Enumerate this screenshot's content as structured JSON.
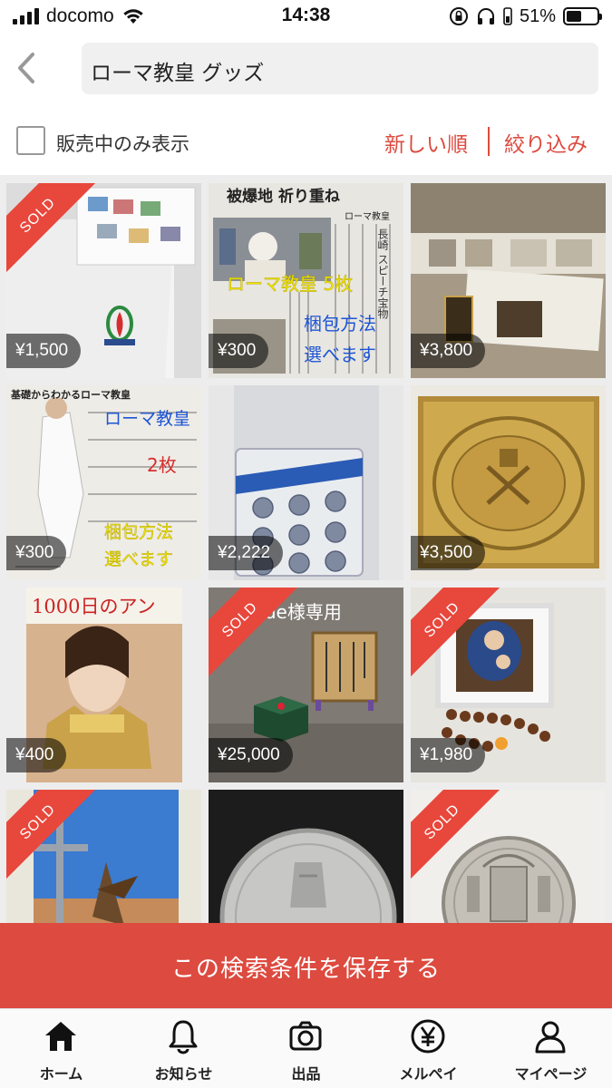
{
  "status_bar": {
    "carrier": "docomo",
    "time": "14:38",
    "battery": "51%",
    "battery_level": 0.51
  },
  "search": {
    "query": "ローマ教皇 グッズ"
  },
  "filter": {
    "on_sale_only_label": "販売中のみ表示",
    "sort_label": "新しい順",
    "filter_label": "絞り込み"
  },
  "items": [
    {
      "price": "¥1,500",
      "sold": true,
      "sold_label": "SOLD"
    },
    {
      "price": "¥300",
      "sold": false,
      "image_text": [
        "被爆地 祈り重ね",
        "ローマ教皇",
        "長崎 スピーチ宝物",
        "ローマ教皇 5枚",
        "梱包方法",
        "選べます"
      ]
    },
    {
      "price": "¥3,800",
      "sold": false
    },
    {
      "price": "¥300",
      "sold": false,
      "image_text": [
        "基礎からわかるローマ教皇",
        "ローマ教皇",
        "2枚",
        "梱包方法",
        "選べます"
      ]
    },
    {
      "price": "¥2,222",
      "sold": false
    },
    {
      "price": "¥3,500",
      "sold": false
    },
    {
      "price": "¥400",
      "sold": false,
      "image_text": [
        "1000日のアン"
      ]
    },
    {
      "price": "¥25,000",
      "sold": true,
      "sold_label": "SOLD",
      "image_text": [
        "yde様専用"
      ]
    },
    {
      "price": "¥1,980",
      "sold": true,
      "sold_label": "SOLD"
    },
    {
      "price": "",
      "sold": true,
      "sold_label": "SOLD"
    },
    {
      "price": "",
      "sold": false
    },
    {
      "price": "",
      "sold": true,
      "sold_label": "SOLD"
    }
  ],
  "save_search": {
    "label": "この検索条件を保存する"
  },
  "tabs": [
    {
      "label": "ホーム",
      "icon": "home-icon"
    },
    {
      "label": "お知らせ",
      "icon": "bell-icon"
    },
    {
      "label": "出品",
      "icon": "camera-icon"
    },
    {
      "label": "メルペイ",
      "icon": "yen-icon"
    },
    {
      "label": "マイページ",
      "icon": "person-icon"
    }
  ],
  "colors": {
    "accent": "#dd4a3f",
    "sold_ribbon": "#e8473c"
  }
}
